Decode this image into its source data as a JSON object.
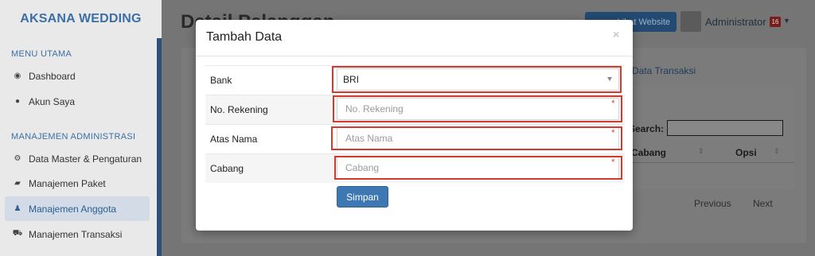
{
  "sidebar": {
    "brand": "AKSANA WEDDING",
    "section1": "MENU UTAMA",
    "section2": "MANAJEMEN ADMINISTRASI",
    "items": [
      {
        "label": "Dashboard",
        "icon": "dashboard-icon"
      },
      {
        "label": "Akun Saya",
        "icon": "user-icon"
      },
      {
        "label": "Data Master & Pengaturan",
        "icon": "gears-icon"
      },
      {
        "label": "Manajemen Paket",
        "icon": "book-icon"
      },
      {
        "label": "Manajemen Anggota",
        "icon": "users-icon",
        "active": true
      },
      {
        "label": "Manajemen Transaksi",
        "icon": "cart-icon"
      }
    ]
  },
  "background": {
    "page_title": "Detail Pelanggan",
    "top_button": "Lihat Website",
    "user_name": "Administrator",
    "badge_count": "16",
    "tab_label": "Data Transaksi",
    "search_label": "Search:",
    "columns": [
      "Cabang",
      "Opsi"
    ],
    "pagination": {
      "previous": "Previous",
      "next": "Next"
    }
  },
  "modal": {
    "title": "Tambah Data",
    "close": "×",
    "fields": {
      "bank": {
        "label": "Bank",
        "value": "BRI"
      },
      "rekening": {
        "label": "No. Rekening",
        "placeholder": "No. Rekening"
      },
      "atas_nama": {
        "label": "Atas Nama",
        "placeholder": "Atas Nama"
      },
      "cabang": {
        "label": "Cabang",
        "placeholder": "Cabang"
      }
    },
    "required_mark": "*",
    "save_label": "Simpan"
  },
  "colors": {
    "primary": "#3e78b3",
    "highlight": "#d23a2e",
    "required": "#d9534f"
  }
}
